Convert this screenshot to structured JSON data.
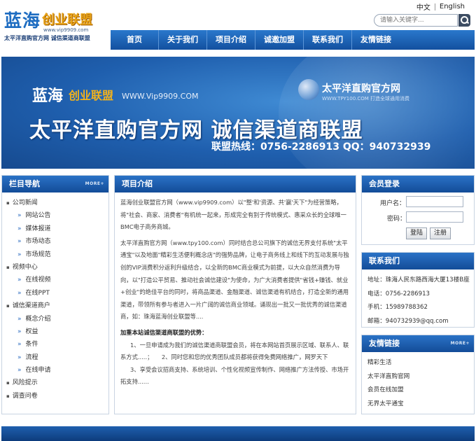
{
  "header": {
    "logo": {
      "cn_blue": "蓝海",
      "cn_orange": "创业联盟",
      "url": "www.vip9909.com",
      "slogan": "太平洋直购官方网  诚信渠道商联盟"
    },
    "lang": {
      "chinese": "中文",
      "english": "English"
    },
    "search": {
      "placeholder": "请输入关键字..."
    },
    "nav": [
      "首页",
      "关于我们",
      "项目介绍",
      "诚邀加盟",
      "联系我们",
      "友情链接"
    ]
  },
  "banner": {
    "logo_blue": "蓝海",
    "logo_orange": "创业联盟",
    "url": "WWW.Vip9909.COM",
    "brand": "太平洋直购官方网",
    "brand_url": "WWW.TPY100.COM 打造全球通用消费",
    "title": "太平洋直购官方网  诚信渠道商联盟",
    "hotline": "联盟热线：0756-2286913   QQ：940732939"
  },
  "leftnav": {
    "title": "栏目导航",
    "more": "MORE+",
    "items": [
      {
        "label": "公司新闻",
        "level": "cat"
      },
      {
        "label": "网站公告",
        "level": "sub"
      },
      {
        "label": "媒体报道",
        "level": "sub"
      },
      {
        "label": "市场动态",
        "level": "sub"
      },
      {
        "label": "市场规范",
        "level": "sub"
      },
      {
        "label": "视频中心",
        "level": "cat"
      },
      {
        "label": "在线视频",
        "level": "sub"
      },
      {
        "label": "在线PPT",
        "level": "sub"
      },
      {
        "label": "诚信渠道商户",
        "level": "cat"
      },
      {
        "label": "概念介绍",
        "level": "sub"
      },
      {
        "label": "权益",
        "level": "sub"
      },
      {
        "label": "条件",
        "level": "sub"
      },
      {
        "label": "流程",
        "level": "sub"
      },
      {
        "label": "在线申请",
        "level": "sub"
      },
      {
        "label": "风险提示",
        "level": "cat"
      },
      {
        "label": "调查问卷",
        "level": "cat"
      }
    ]
  },
  "content": {
    "title": "项目介绍",
    "para1": "蓝海创业联盟官方网（www.vip9909.com）以\"整'和'资源、共'赢'天下\"为经营策略，将\"社会、商家、消费者\"有机统一起来，形成完全有别于传统模式、惠采众长的全球唯一BMC电子商务商城。",
    "para2": "太平洋直购官方网（www.tpy100.com）同时结合总公司旗下的诚信无界支付系统\"太平通宝\"以及地面\"精彩生活便利概念店\"的强势品牌，让电子商务线上和线下的互动发展与独创的VIP消费积分返利升级结合，以全新的BMC商业模式为前提，以大众自然消费为导向，以\"打造公平贸易、推动社会诚信建设\"为使命，为广大消费者提供\"省钱+赚钱、就业+创业\"的绝佳平台的同时，将商品渠道、金融渠道、诚信渠道有机结合，打造全新的通用渠道，带领所有参与者进入一片广阔的诚信商业领域。诵现出一批又一批优秀的诚信渠道商，如：珠海蓝海创业联盟等....",
    "adv_title": "加重本站诚信渠道商联盟的优势：",
    "adv1": "1、一旦申请成为我们的诚信渠道商联盟会员，将在本网站首页展示区域、联系人、联系方式.....；　　2、同时您和您的优秀团队成员都将获得免费网络推广，网罗天下",
    "adv3": "3、享受会议招商支持、系统培训、个性化视频宣传制作、网络推广方法传授、市场开拓支持......"
  },
  "login": {
    "title": "会员登录",
    "user_label": "用户名：",
    "pass_label": "密码：",
    "login_btn": "登陆",
    "register_btn": "注册"
  },
  "contact": {
    "title": "联系我们",
    "lines": [
      "地址：珠海人民东路西海大厦13楼B座",
      "电话：0756-2286913",
      "手机：15989788362",
      "邮箱：940732939@qq.com"
    ]
  },
  "links": {
    "title": "友情链接",
    "more": "MORE+",
    "items": [
      "精彩生活",
      "太平洋直购官网",
      "会员在线加盟",
      "无界太平通宝"
    ]
  }
}
